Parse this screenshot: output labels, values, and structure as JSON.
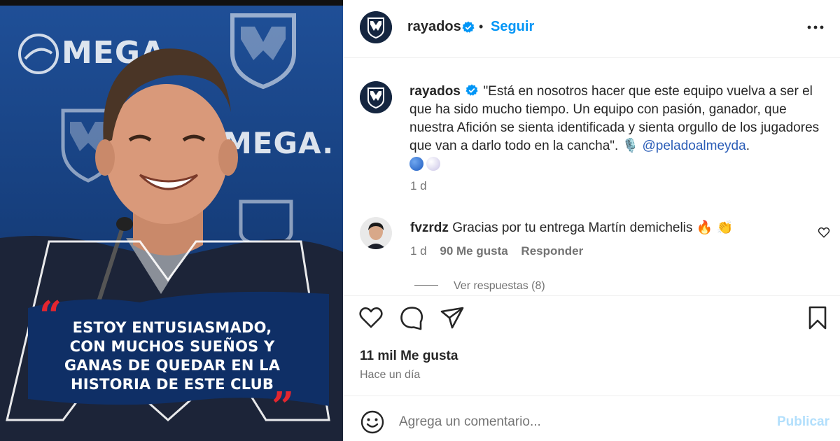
{
  "media": {
    "brand_text_top": "MEGA",
    "brand_text_mid": "MEGA.",
    "quote_lines": [
      "ESTOY ENTUSIASMADO,",
      "CON MUCHOS SUEÑOS Y",
      "GANAS DE QUEDAR EN LA",
      "HISTORIA DE ESTE CLUB"
    ],
    "quote_color": "#e3262f"
  },
  "header": {
    "username": "rayados",
    "separator": "•",
    "follow_label": "Seguir"
  },
  "caption": {
    "username": "rayados",
    "text": "\"Está en nosotros hacer que este equipo vuelva a ser el que ha sido mucho tiempo. Un equipo con pasión, ganador, que nuestra Afición se sienta identificada y sienta orgullo de los jugadores que van a darlo todo en la cancha\". 🎙️ ",
    "mention": "@peladoalmeyda",
    "mention_suffix": ".",
    "time": "1 d"
  },
  "comment": {
    "username": "fvzrdz",
    "text": "Gracias por tu entrega Martín demichelis 🔥 👏",
    "time": "1 d",
    "likes": "90 Me gusta",
    "reply_label": "Responder",
    "view_replies": "Ver respuestas (8)"
  },
  "stats": {
    "likes": "11 mil Me gusta",
    "time_ago": "Hace un día"
  },
  "compose": {
    "placeholder": "Agrega un comentario...",
    "publish_label": "Publicar"
  },
  "colors": {
    "accent": "#0095f6",
    "publish_disabled": "#b2dffc",
    "verified": "#0095f6"
  }
}
